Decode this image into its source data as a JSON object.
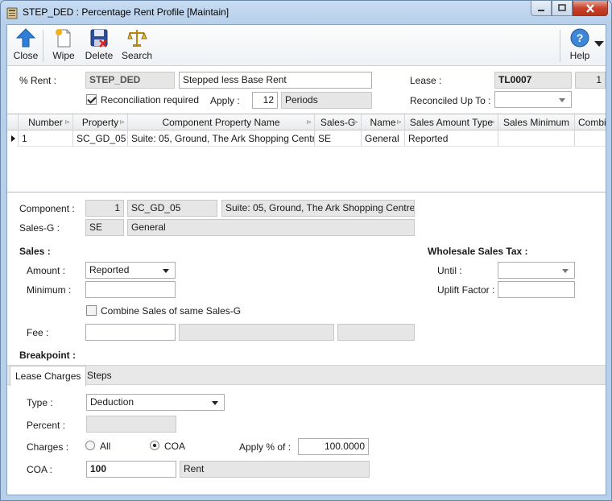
{
  "window": {
    "title": "STEP_DED : Percentage Rent Profile [Maintain]"
  },
  "toolbar": {
    "close": "Close",
    "wipe": "Wipe",
    "delete": "Delete",
    "search": "Search",
    "help": "Help"
  },
  "header": {
    "rent_label": "% Rent :",
    "rent_code": "STEP_DED",
    "rent_desc": "Stepped less Base Rent",
    "lease_label": "Lease :",
    "lease_code": "TL0007",
    "lease_num": "1",
    "reconciliation_label": "Reconciliation required",
    "reconciliation_checked": true,
    "apply_label": "Apply :",
    "apply_value": "12",
    "apply_unit": "Periods",
    "reconciled_label": "Reconciled Up To :",
    "reconciled_value": ""
  },
  "grid": {
    "columns": [
      "Number",
      "Property",
      "Component Property Name",
      "Sales-G",
      "Name",
      "Sales Amount Type",
      "Sales Minimum",
      "Combi"
    ],
    "rows": [
      [
        "1",
        "SC_GD_05",
        "Suite: 05, Ground, The Ark Shopping Centre",
        "SE",
        "General",
        "Reported",
        "",
        ""
      ]
    ]
  },
  "component": {
    "label": "Component :",
    "number": "1",
    "code": "SC_GD_05",
    "name": "Suite: 05, Ground, The Ark Shopping Centre",
    "salesg_label": "Sales-G :",
    "salesg_code": "SE",
    "salesg_name": "General"
  },
  "sales": {
    "heading": "Sales :",
    "amount_label": "Amount :",
    "amount_value": "Reported",
    "minimum_label": "Minimum :",
    "minimum_value": "",
    "combine_label": "Combine Sales of same Sales-G",
    "combine_checked": false,
    "fee_label": "Fee :",
    "fee_value": ""
  },
  "wholesale": {
    "heading": "Wholesale Sales Tax :",
    "until_label": "Until :",
    "until_value": "",
    "uplift_label": "Uplift Factor :",
    "uplift_value": ""
  },
  "breakpoint": {
    "heading": "Breakpoint :"
  },
  "tabs": [
    "Lease Charges",
    "Steps"
  ],
  "lease_charges": {
    "type_label": "Type :",
    "type_value": "Deduction",
    "percent_label": "Percent :",
    "percent_value": "",
    "charges_label": "Charges :",
    "charges_all": "All",
    "charges_coa": "COA",
    "charges_selected": "COA",
    "applypct_label": "Apply % of :",
    "applypct_value": "100.0000",
    "coa_label": "COA :",
    "coa_code": "100",
    "coa_name": "Rent"
  }
}
